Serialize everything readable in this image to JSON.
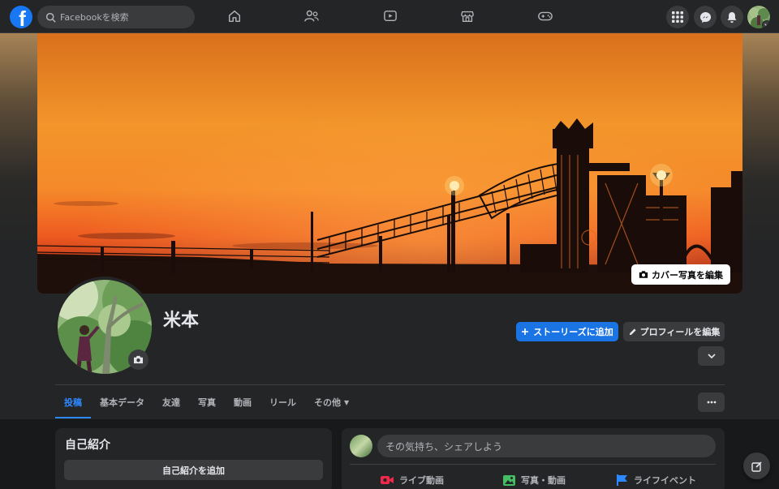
{
  "topbar": {
    "logo_letter": "f",
    "search_placeholder": "Facebookを検索",
    "nav_icons": [
      "home-icon",
      "friends-icon",
      "watch-icon",
      "marketplace-icon",
      "gaming-icon"
    ],
    "right_icons": [
      "menu-grid-icon",
      "messenger-icon",
      "notifications-icon"
    ],
    "accent": "#1877f2"
  },
  "cover": {
    "edit_label": "カバー写真を編集"
  },
  "profile": {
    "name": "米本",
    "add_story_label": "ストーリーズに追加",
    "edit_profile_label": "プロフィールを編集"
  },
  "tabs": [
    {
      "label": "投稿",
      "active": true
    },
    {
      "label": "基本データ"
    },
    {
      "label": "友達"
    },
    {
      "label": "写真"
    },
    {
      "label": "動画"
    },
    {
      "label": "リール"
    },
    {
      "label": "その他"
    }
  ],
  "intro": {
    "title": "自己紹介",
    "add_button": "自己紹介を追加"
  },
  "composer": {
    "placeholder": "その気持ち、シェアしよう",
    "actions": [
      {
        "label": "ライブ動画",
        "color": "#f02849"
      },
      {
        "label": "写真・動画",
        "color": "#45bd62"
      },
      {
        "label": "ライフイベント",
        "color": "#2d88ff"
      }
    ]
  }
}
